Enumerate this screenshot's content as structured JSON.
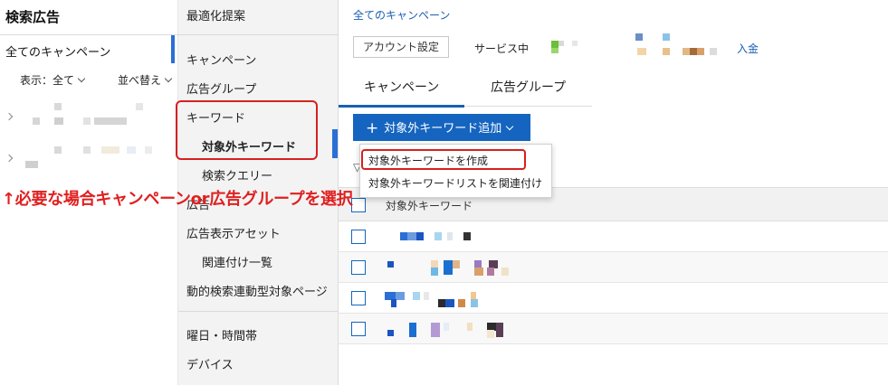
{
  "left_panel": {
    "title": "検索広告",
    "all_campaigns": "全てのキャンペーン",
    "display_filter": "表示：全て",
    "sort_filter": "並べ替え"
  },
  "nav": {
    "optimization": "最適化提案",
    "campaign": "キャンペーン",
    "ad_group": "広告グループ",
    "keyword": "キーワード",
    "negative_keyword": "対象外キーワード",
    "search_query": "検索クエリー",
    "ad": "広告",
    "ad_assets": "広告表示アセット",
    "linked_list": "関連付け一覧",
    "dynamic_search": "動的検索連動型対象ページ",
    "day_time": "曜日・時間帯",
    "device": "デバイス"
  },
  "main": {
    "breadcrumb": "全てのキャンペーン",
    "account_settings": "アカウント設定",
    "service_status": "サービス中",
    "deposit": "入金",
    "tabs": [
      "キャンペーン",
      "広告グループ"
    ],
    "add_button": "対象外キーワード追加",
    "dropdown_options": [
      "対象外キーワードを作成",
      "対象外キーワードリストを関連付け"
    ],
    "column_header": "対象外キーワード"
  },
  "annotation": "↑必要な場合キャンペーンor広告グループを選択",
  "colors": {
    "accent": "#1565c0",
    "link": "#1a5fb4",
    "highlight": "#d62020"
  }
}
